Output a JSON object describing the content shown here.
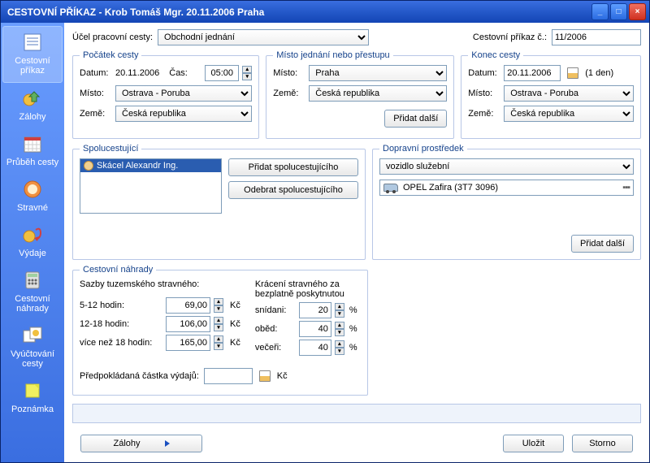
{
  "window": {
    "title": "CESTOVNÍ PŘÍKAZ - Krob Tomáš Mgr. 20.11.2006  Praha"
  },
  "sidebar": {
    "items": [
      {
        "label": "Cestovní příkaz"
      },
      {
        "label": "Zálohy"
      },
      {
        "label": "Průběh cesty"
      },
      {
        "label": "Stravné"
      },
      {
        "label": "Výdaje"
      },
      {
        "label": "Cestovní náhrady"
      },
      {
        "label": "Vyúčtování cesty"
      },
      {
        "label": "Poznámka"
      }
    ]
  },
  "top": {
    "ucel_label": "Účel pracovní cesty:",
    "ucel_value": "Obchodní jednání",
    "prikaz_label": "Cestovní příkaz č.:",
    "prikaz_value": "11/2006"
  },
  "pocatek": {
    "legend": "Počátek cesty",
    "datum_label": "Datum:",
    "datum": "20.11.2006",
    "cas_label": "Čas:",
    "cas": "05:00",
    "misto_label": "Místo:",
    "misto": "Ostrava - Poruba",
    "zeme_label": "Země:",
    "zeme": "Česká republika"
  },
  "jednani": {
    "legend": "Místo jednání nebo přestupu",
    "misto_label": "Místo:",
    "misto": "Praha",
    "zeme_label": "Země:",
    "zeme": "Česká republika",
    "pridat": "Přidat další"
  },
  "konec": {
    "legend": "Konec cesty",
    "datum_label": "Datum:",
    "datum": "20.11.2006",
    "dny": "(1 den)",
    "misto_label": "Místo:",
    "misto": "Ostrava - Poruba",
    "zeme_label": "Země:",
    "zeme": "Česká republika"
  },
  "spolucest": {
    "legend": "Spolucestující",
    "person": "Skácel Alexandr Ing.",
    "pridat": "Přidat spolucestujícího",
    "odebrat": "Odebrat spolucestujícího"
  },
  "doprava": {
    "legend": "Dopravní prostředek",
    "typ": "vozidlo služební",
    "auto": "OPEL Zafira  (3T7 3096)",
    "pridat": "Přidat další"
  },
  "nahrady": {
    "legend": "Cestovní náhrady",
    "sazby_label": "Sazby tuzemského stravného:",
    "r1_label": "5-12 hodin:",
    "r1_val": "69,00",
    "r2_label": "12-18 hodin:",
    "r2_val": "106,00",
    "r3_label": "více než 18 hodin:",
    "r3_val": "165,00",
    "kc": "Kč",
    "kraceni_label": "Krácení stravného za bezplatně poskytnutou",
    "snidani_label": "snídani:",
    "snidani_val": "20",
    "obed_label": "oběd:",
    "obed_val": "40",
    "vecere_label": "večeři:",
    "vecere_val": "40",
    "pct": "%",
    "predpokl_label": "Předpokládaná částka výdajů:",
    "predpokl_val": ""
  },
  "footer": {
    "zalohy": "Zálohy",
    "ulozit": "Uložit",
    "storno": "Storno"
  }
}
